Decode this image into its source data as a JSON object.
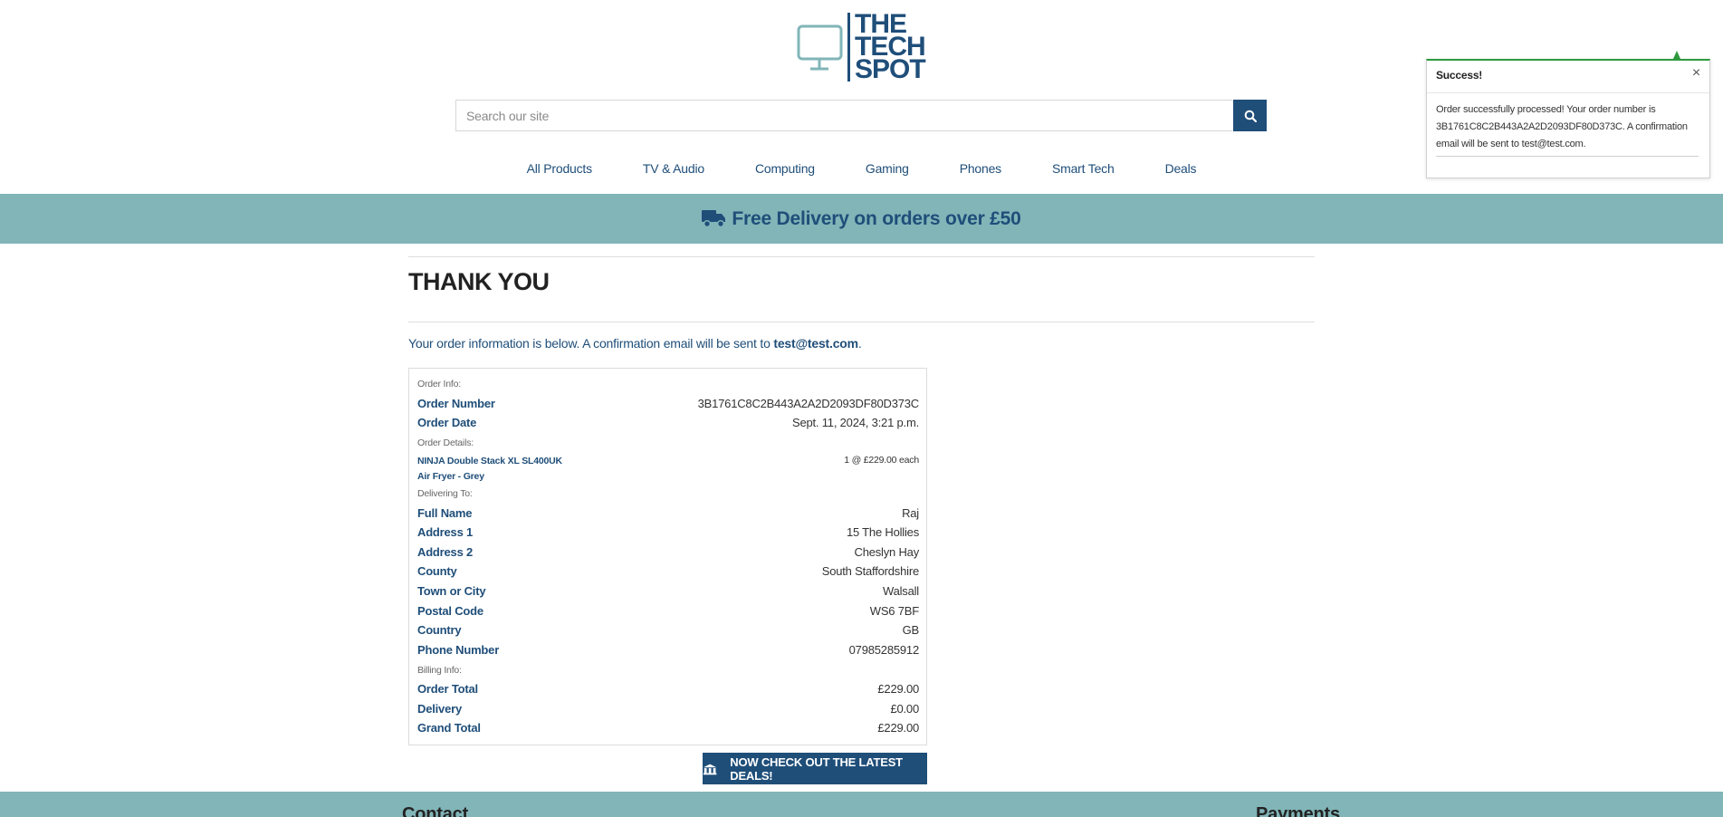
{
  "header": {
    "logo_lines": [
      "THE",
      "TECH",
      "SPOT"
    ],
    "search_placeholder": "Search our site"
  },
  "nav": [
    "All Products",
    "TV & Audio",
    "Computing",
    "Gaming",
    "Phones",
    "Smart Tech",
    "Deals"
  ],
  "banner": {
    "text": "Free Delivery on orders over £50"
  },
  "main": {
    "title": "THANK YOU",
    "intro_prefix": "Your order information is below. A confirmation email will be sent to ",
    "intro_email": "test@test.com",
    "intro_suffix": "."
  },
  "order": {
    "order_info_label": "Order Info:",
    "order_number_label": "Order Number",
    "order_number": "3B1761C8C2B443A2A2D2093DF80D373C",
    "order_date_label": "Order Date",
    "order_date": "Sept. 11, 2024, 3:21 p.m.",
    "order_details_label": "Order Details:",
    "item_name": "NINJA Double Stack XL SL400UK Air Fryer - Grey",
    "item_qty": "1 @ £229.00 each",
    "delivering_label": "Delivering To:",
    "delivery": [
      {
        "label": "Full Name",
        "value": "Raj"
      },
      {
        "label": "Address 1",
        "value": "15 The Hollies"
      },
      {
        "label": "Address 2",
        "value": "Cheslyn Hay"
      },
      {
        "label": "County",
        "value": "South Staffordshire"
      },
      {
        "label": "Town or City",
        "value": "Walsall"
      },
      {
        "label": "Postal Code",
        "value": "WS6 7BF"
      },
      {
        "label": "Country",
        "value": "GB"
      },
      {
        "label": "Phone Number",
        "value": "07985285912"
      }
    ],
    "billing_label": "Billing Info:",
    "billing": [
      {
        "label": "Order Total",
        "value": "£229.00"
      },
      {
        "label": "Delivery",
        "value": "£0.00"
      },
      {
        "label": "Grand Total",
        "value": "£229.00"
      }
    ]
  },
  "deals_button": "NOW CHECK OUT THE LATEST DEALS!",
  "footer": {
    "contact": "Contact",
    "payments": "Payments"
  },
  "toast": {
    "title": "Success!",
    "close": "×",
    "message": "Order successfully processed! Your order number is 3B1761C8C2B443A2A2D2093DF80D373C. A confirmation email will be sent to test@test.com."
  },
  "colors": {
    "brand": "#1f4e79",
    "teal": "#81b5b8",
    "success": "#2e9a3e"
  }
}
